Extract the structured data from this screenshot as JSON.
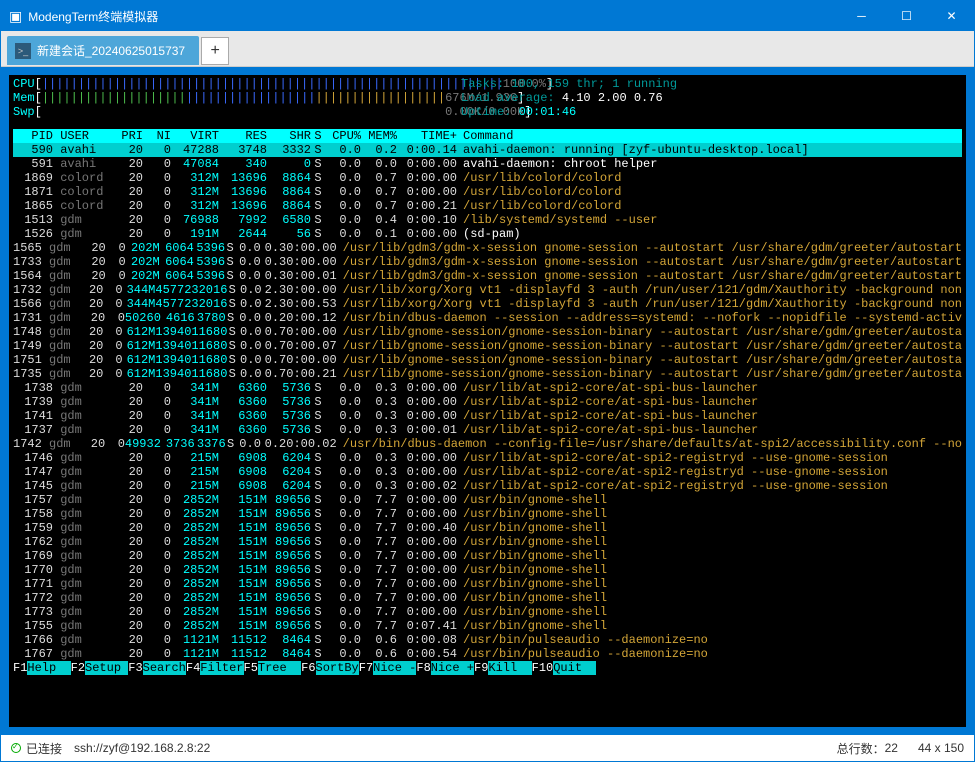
{
  "window": {
    "title": "ModengTerm终端模拟器"
  },
  "tabs": {
    "active": "新建会话_20240625015737"
  },
  "status": {
    "state": "已连接",
    "target": "ssh://zyf@192.168.2.8:22",
    "lines_label": "总行数：",
    "lines": "22",
    "size": "44 x 150"
  },
  "htop": {
    "meters": {
      "cpu_label": "CPU",
      "cpu_pct": "100.0%",
      "mem_label": "Mem",
      "mem_used": "676M",
      "mem_total": "1.93G",
      "swp_label": "Swp",
      "swp_used": "0.00K",
      "swp_total": "0.00K",
      "tasks": "Tasks: 100, 159 thr; 1 running",
      "load_label": "Load average:",
      "load_vals": "4.10 2.00 0.76",
      "uptime_label": "Uptime:",
      "uptime": "00:01:46"
    },
    "columns": [
      "PID",
      "USER",
      "PRI",
      "NI",
      "VIRT",
      "RES",
      "SHR",
      "S",
      "CPU%",
      "MEM%",
      "TIME+",
      "Command"
    ],
    "rows": [
      {
        "pid": "590",
        "user": "avahi",
        "pri": "20",
        "ni": "0",
        "virt": "47288",
        "res": "3748",
        "shr": "3332",
        "s": "S",
        "cpu": "0.0",
        "mem": "0.2",
        "time": "0:00.14",
        "cmd": "avahi-daemon: running [zyf-ubuntu-desktop.local]",
        "sel": true
      },
      {
        "pid": "591",
        "user": "avahi",
        "pri": "20",
        "ni": "0",
        "virt": "47084",
        "res": "340",
        "shr": "0",
        "s": "S",
        "cpu": "0.0",
        "mem": "0.0",
        "time": "0:00.00",
        "cmd": "avahi-daemon: chroot helper",
        "cmdcolor": "white"
      },
      {
        "pid": "1869",
        "user": "colord",
        "pri": "20",
        "ni": "0",
        "virt": "312M",
        "res": "13696",
        "shr": "8864",
        "s": "S",
        "cpu": "0.0",
        "mem": "0.7",
        "time": "0:00.00",
        "cmd": "/usr/lib/colord/colord"
      },
      {
        "pid": "1871",
        "user": "colord",
        "pri": "20",
        "ni": "0",
        "virt": "312M",
        "res": "13696",
        "shr": "8864",
        "s": "S",
        "cpu": "0.0",
        "mem": "0.7",
        "time": "0:00.00",
        "cmd": "/usr/lib/colord/colord"
      },
      {
        "pid": "1865",
        "user": "colord",
        "pri": "20",
        "ni": "0",
        "virt": "312M",
        "res": "13696",
        "shr": "8864",
        "s": "S",
        "cpu": "0.0",
        "mem": "0.7",
        "time": "0:00.21",
        "cmd": "/usr/lib/colord/colord"
      },
      {
        "pid": "1513",
        "user": "gdm",
        "pri": "20",
        "ni": "0",
        "virt": "76988",
        "res": "7992",
        "shr": "6580",
        "s": "S",
        "cpu": "0.0",
        "mem": "0.4",
        "time": "0:00.10",
        "cmd": "/lib/systemd/systemd --user"
      },
      {
        "pid": "1526",
        "user": "gdm",
        "pri": "20",
        "ni": "0",
        "virt": "191M",
        "res": "2644",
        "shr": "56",
        "s": "S",
        "cpu": "0.0",
        "mem": "0.1",
        "time": "0:00.00",
        "cmd": "(sd-pam)",
        "cmdcolor": "white"
      },
      {
        "pid": "1565",
        "user": "gdm",
        "pri": "20",
        "ni": "0",
        "virt": "202M",
        "res": "6064",
        "shr": "5396",
        "s": "S",
        "cpu": "0.0",
        "mem": "0.3",
        "time": "0:00.00",
        "cmd": "/usr/lib/gdm3/gdm-x-session gnome-session --autostart /usr/share/gdm/greeter/autostart"
      },
      {
        "pid": "1733",
        "user": "gdm",
        "pri": "20",
        "ni": "0",
        "virt": "202M",
        "res": "6064",
        "shr": "5396",
        "s": "S",
        "cpu": "0.0",
        "mem": "0.3",
        "time": "0:00.00",
        "cmd": "/usr/lib/gdm3/gdm-x-session gnome-session --autostart /usr/share/gdm/greeter/autostart"
      },
      {
        "pid": "1564",
        "user": "gdm",
        "pri": "20",
        "ni": "0",
        "virt": "202M",
        "res": "6064",
        "shr": "5396",
        "s": "S",
        "cpu": "0.0",
        "mem": "0.3",
        "time": "0:00.01",
        "cmd": "/usr/lib/gdm3/gdm-x-session gnome-session --autostart /usr/share/gdm/greeter/autostart"
      },
      {
        "pid": "1732",
        "user": "gdm",
        "pri": "20",
        "ni": "0",
        "virt": "344M",
        "res": "45772",
        "shr": "32016",
        "s": "S",
        "cpu": "0.0",
        "mem": "2.3",
        "time": "0:00.00",
        "cmd": "/usr/lib/xorg/Xorg vt1 -displayfd 3 -auth /run/user/121/gdm/Xauthority -background non"
      },
      {
        "pid": "1566",
        "user": "gdm",
        "pri": "20",
        "ni": "0",
        "virt": "344M",
        "res": "45772",
        "shr": "32016",
        "s": "S",
        "cpu": "0.0",
        "mem": "2.3",
        "time": "0:00.53",
        "cmd": "/usr/lib/xorg/Xorg vt1 -displayfd 3 -auth /run/user/121/gdm/Xauthority -background non"
      },
      {
        "pid": "1731",
        "user": "gdm",
        "pri": "20",
        "ni": "0",
        "virt": "50260",
        "res": "4616",
        "shr": "3780",
        "s": "S",
        "cpu": "0.0",
        "mem": "0.2",
        "time": "0:00.12",
        "cmd": "/usr/bin/dbus-daemon --session --address=systemd: --nofork --nopidfile --systemd-activ"
      },
      {
        "pid": "1748",
        "user": "gdm",
        "pri": "20",
        "ni": "0",
        "virt": "612M",
        "res": "13940",
        "shr": "11680",
        "s": "S",
        "cpu": "0.0",
        "mem": "0.7",
        "time": "0:00.00",
        "cmd": "/usr/lib/gnome-session/gnome-session-binary --autostart /usr/share/gdm/greeter/autosta"
      },
      {
        "pid": "1749",
        "user": "gdm",
        "pri": "20",
        "ni": "0",
        "virt": "612M",
        "res": "13940",
        "shr": "11680",
        "s": "S",
        "cpu": "0.0",
        "mem": "0.7",
        "time": "0:00.07",
        "cmd": "/usr/lib/gnome-session/gnome-session-binary --autostart /usr/share/gdm/greeter/autosta"
      },
      {
        "pid": "1751",
        "user": "gdm",
        "pri": "20",
        "ni": "0",
        "virt": "612M",
        "res": "13940",
        "shr": "11680",
        "s": "S",
        "cpu": "0.0",
        "mem": "0.7",
        "time": "0:00.00",
        "cmd": "/usr/lib/gnome-session/gnome-session-binary --autostart /usr/share/gdm/greeter/autosta"
      },
      {
        "pid": "1735",
        "user": "gdm",
        "pri": "20",
        "ni": "0",
        "virt": "612M",
        "res": "13940",
        "shr": "11680",
        "s": "S",
        "cpu": "0.0",
        "mem": "0.7",
        "time": "0:00.21",
        "cmd": "/usr/lib/gnome-session/gnome-session-binary --autostart /usr/share/gdm/greeter/autosta"
      },
      {
        "pid": "1738",
        "user": "gdm",
        "pri": "20",
        "ni": "0",
        "virt": "341M",
        "res": "6360",
        "shr": "5736",
        "s": "S",
        "cpu": "0.0",
        "mem": "0.3",
        "time": "0:00.00",
        "cmd": "/usr/lib/at-spi2-core/at-spi-bus-launcher"
      },
      {
        "pid": "1739",
        "user": "gdm",
        "pri": "20",
        "ni": "0",
        "virt": "341M",
        "res": "6360",
        "shr": "5736",
        "s": "S",
        "cpu": "0.0",
        "mem": "0.3",
        "time": "0:00.00",
        "cmd": "/usr/lib/at-spi2-core/at-spi-bus-launcher"
      },
      {
        "pid": "1741",
        "user": "gdm",
        "pri": "20",
        "ni": "0",
        "virt": "341M",
        "res": "6360",
        "shr": "5736",
        "s": "S",
        "cpu": "0.0",
        "mem": "0.3",
        "time": "0:00.00",
        "cmd": "/usr/lib/at-spi2-core/at-spi-bus-launcher"
      },
      {
        "pid": "1737",
        "user": "gdm",
        "pri": "20",
        "ni": "0",
        "virt": "341M",
        "res": "6360",
        "shr": "5736",
        "s": "S",
        "cpu": "0.0",
        "mem": "0.3",
        "time": "0:00.01",
        "cmd": "/usr/lib/at-spi2-core/at-spi-bus-launcher"
      },
      {
        "pid": "1742",
        "user": "gdm",
        "pri": "20",
        "ni": "0",
        "virt": "49932",
        "res": "3736",
        "shr": "3376",
        "s": "S",
        "cpu": "0.0",
        "mem": "0.2",
        "time": "0:00.02",
        "cmd": "/usr/bin/dbus-daemon --config-file=/usr/share/defaults/at-spi2/accessibility.conf --no"
      },
      {
        "pid": "1746",
        "user": "gdm",
        "pri": "20",
        "ni": "0",
        "virt": "215M",
        "res": "6908",
        "shr": "6204",
        "s": "S",
        "cpu": "0.0",
        "mem": "0.3",
        "time": "0:00.00",
        "cmd": "/usr/lib/at-spi2-core/at-spi2-registryd --use-gnome-session"
      },
      {
        "pid": "1747",
        "user": "gdm",
        "pri": "20",
        "ni": "0",
        "virt": "215M",
        "res": "6908",
        "shr": "6204",
        "s": "S",
        "cpu": "0.0",
        "mem": "0.3",
        "time": "0:00.00",
        "cmd": "/usr/lib/at-spi2-core/at-spi2-registryd --use-gnome-session"
      },
      {
        "pid": "1745",
        "user": "gdm",
        "pri": "20",
        "ni": "0",
        "virt": "215M",
        "res": "6908",
        "shr": "6204",
        "s": "S",
        "cpu": "0.0",
        "mem": "0.3",
        "time": "0:00.02",
        "cmd": "/usr/lib/at-spi2-core/at-spi2-registryd --use-gnome-session"
      },
      {
        "pid": "1757",
        "user": "gdm",
        "pri": "20",
        "ni": "0",
        "virt": "2852M",
        "res": "151M",
        "shr": "89656",
        "s": "S",
        "cpu": "0.0",
        "mem": "7.7",
        "time": "0:00.00",
        "cmd": "/usr/bin/gnome-shell"
      },
      {
        "pid": "1758",
        "user": "gdm",
        "pri": "20",
        "ni": "0",
        "virt": "2852M",
        "res": "151M",
        "shr": "89656",
        "s": "S",
        "cpu": "0.0",
        "mem": "7.7",
        "time": "0:00.00",
        "cmd": "/usr/bin/gnome-shell"
      },
      {
        "pid": "1759",
        "user": "gdm",
        "pri": "20",
        "ni": "0",
        "virt": "2852M",
        "res": "151M",
        "shr": "89656",
        "s": "S",
        "cpu": "0.0",
        "mem": "7.7",
        "time": "0:00.40",
        "cmd": "/usr/bin/gnome-shell"
      },
      {
        "pid": "1762",
        "user": "gdm",
        "pri": "20",
        "ni": "0",
        "virt": "2852M",
        "res": "151M",
        "shr": "89656",
        "s": "S",
        "cpu": "0.0",
        "mem": "7.7",
        "time": "0:00.00",
        "cmd": "/usr/bin/gnome-shell"
      },
      {
        "pid": "1769",
        "user": "gdm",
        "pri": "20",
        "ni": "0",
        "virt": "2852M",
        "res": "151M",
        "shr": "89656",
        "s": "S",
        "cpu": "0.0",
        "mem": "7.7",
        "time": "0:00.00",
        "cmd": "/usr/bin/gnome-shell"
      },
      {
        "pid": "1770",
        "user": "gdm",
        "pri": "20",
        "ni": "0",
        "virt": "2852M",
        "res": "151M",
        "shr": "89656",
        "s": "S",
        "cpu": "0.0",
        "mem": "7.7",
        "time": "0:00.00",
        "cmd": "/usr/bin/gnome-shell"
      },
      {
        "pid": "1771",
        "user": "gdm",
        "pri": "20",
        "ni": "0",
        "virt": "2852M",
        "res": "151M",
        "shr": "89656",
        "s": "S",
        "cpu": "0.0",
        "mem": "7.7",
        "time": "0:00.00",
        "cmd": "/usr/bin/gnome-shell"
      },
      {
        "pid": "1772",
        "user": "gdm",
        "pri": "20",
        "ni": "0",
        "virt": "2852M",
        "res": "151M",
        "shr": "89656",
        "s": "S",
        "cpu": "0.0",
        "mem": "7.7",
        "time": "0:00.00",
        "cmd": "/usr/bin/gnome-shell"
      },
      {
        "pid": "1773",
        "user": "gdm",
        "pri": "20",
        "ni": "0",
        "virt": "2852M",
        "res": "151M",
        "shr": "89656",
        "s": "S",
        "cpu": "0.0",
        "mem": "7.7",
        "time": "0:00.00",
        "cmd": "/usr/bin/gnome-shell"
      },
      {
        "pid": "1755",
        "user": "gdm",
        "pri": "20",
        "ni": "0",
        "virt": "2852M",
        "res": "151M",
        "shr": "89656",
        "s": "S",
        "cpu": "0.0",
        "mem": "7.7",
        "time": "0:07.41",
        "cmd": "/usr/bin/gnome-shell"
      },
      {
        "pid": "1766",
        "user": "gdm",
        "pri": "20",
        "ni": "0",
        "virt": "1121M",
        "res": "11512",
        "shr": "8464",
        "s": "S",
        "cpu": "0.0",
        "mem": "0.6",
        "time": "0:00.08",
        "cmd": "/usr/bin/pulseaudio --daemonize=no"
      },
      {
        "pid": "1767",
        "user": "gdm",
        "pri": "20",
        "ni": "0",
        "virt": "1121M",
        "res": "11512",
        "shr": "8464",
        "s": "S",
        "cpu": "0.0",
        "mem": "0.6",
        "time": "0:00.54",
        "cmd": "/usr/bin/pulseaudio --daemonize=no"
      }
    ],
    "fnkeys": [
      {
        "k": "F1",
        "l": "Help"
      },
      {
        "k": "F2",
        "l": "Setup"
      },
      {
        "k": "F3",
        "l": "Search"
      },
      {
        "k": "F4",
        "l": "Filter"
      },
      {
        "k": "F5",
        "l": "Tree"
      },
      {
        "k": "F6",
        "l": "SortBy"
      },
      {
        "k": "F7",
        "l": "Nice -"
      },
      {
        "k": "F8",
        "l": "Nice +"
      },
      {
        "k": "F9",
        "l": "Kill"
      },
      {
        "k": "F10",
        "l": "Quit"
      }
    ]
  }
}
